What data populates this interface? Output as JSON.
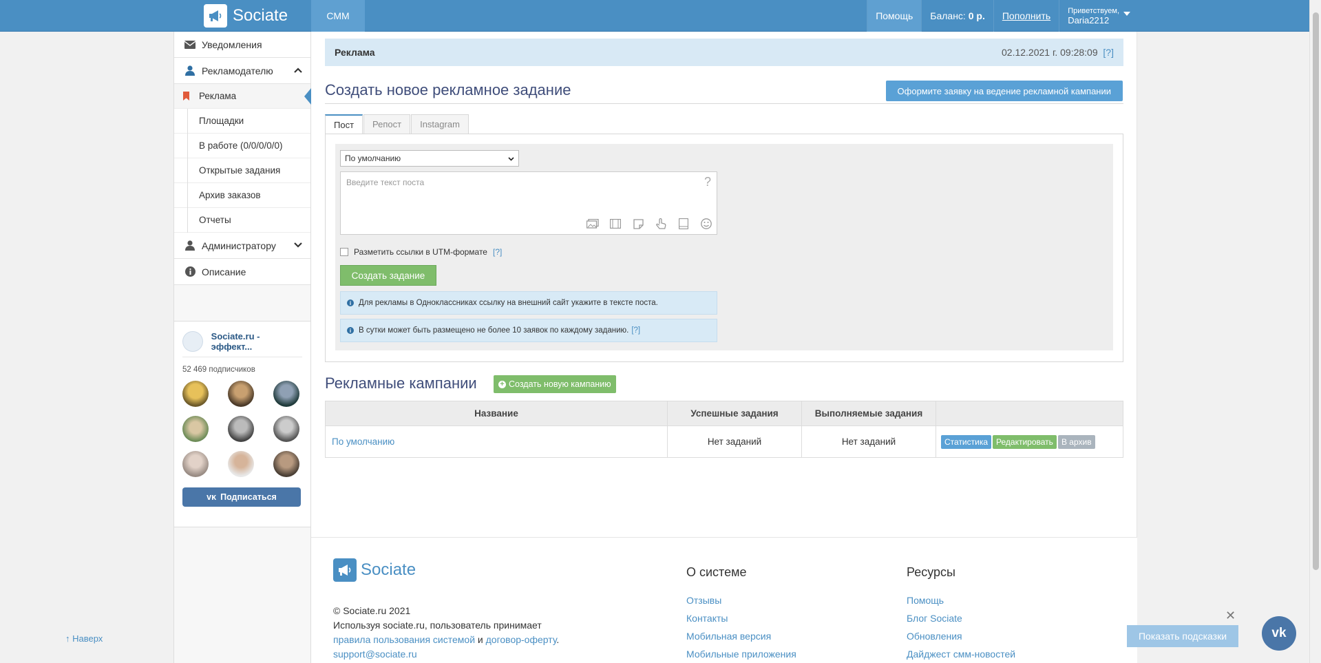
{
  "header": {
    "logo": "Sociate",
    "tab_smm": "СММ",
    "help": "Помощь",
    "balance_label": "Баланс:",
    "balance_value": "0 р.",
    "topup": "Пополнить",
    "greet": "Приветствуем,",
    "user": "Daria2212",
    "accent_color": "#4a8fc3"
  },
  "sidebar": {
    "notifications": "Уведомления",
    "advertiser": "Рекламодателю",
    "sub": [
      "Реклама",
      "Площадки",
      "В работе (0/0/0/0/0)",
      "Открытые задания",
      "Архив заказов",
      "Отчеты"
    ],
    "admin": "Администратору",
    "description": "Описание",
    "vk": {
      "name": "Sociate.ru - эффект...",
      "subscribers": "52 469 подписчиков",
      "subscribe": "Подписаться"
    },
    "up": "↑ Наверх"
  },
  "main": {
    "bar_title": "Реклама",
    "bar_date": "02.12.2021 г. 09:28:09",
    "bar_q": "[?]",
    "create_title": "Создать новое рекламное задание",
    "order_btn": "Оформите заявку на ведение рекламной кампании",
    "tabs": [
      "Пост",
      "Репост",
      "Instagram"
    ],
    "select_value": "По умолчанию",
    "textarea_placeholder": "Введите текст поста",
    "utm_label": "Разметить ссылки в UTM-формате",
    "q": "[?]",
    "create_task": "Создать задание",
    "info1": "Для рекламы в Одноклассниках ссылку на внешний сайт укажите в тексте поста.",
    "info2": "В сутки может быть размещено не более 10 заявок по каждому заданию.",
    "camp_title": "Рекламные кампании",
    "new_camp": "Создать новую кампанию",
    "table": {
      "headers": [
        "Название",
        "Успешные задания",
        "Выполняемые задания",
        ""
      ],
      "rows": [
        {
          "name": "По умолчанию",
          "success": "Нет заданий",
          "running": "Нет заданий",
          "actions": [
            "Статистика",
            "Редактировать",
            "В архив"
          ]
        }
      ]
    }
  },
  "footer": {
    "logo": "Sociate",
    "copy": "© Sociate.ru 2021",
    "line2": "Используя sociate.ru, пользователь принимает",
    "link_rules": "правила пользования системой",
    "and": "и",
    "link_offer": "договор-оферту",
    "dot": ".",
    "email": "support@sociate.ru",
    "about_title": "О системе",
    "about": [
      "Отзывы",
      "Контакты",
      "Мобильная версия",
      "Мобильные приложения"
    ],
    "res_title": "Ресурсы",
    "res": [
      "Помощь",
      "Блог Sociate",
      "Обновления",
      "Дайджест смм-новостей"
    ]
  },
  "hints": {
    "close": "✕",
    "show": "Показать подсказки"
  }
}
